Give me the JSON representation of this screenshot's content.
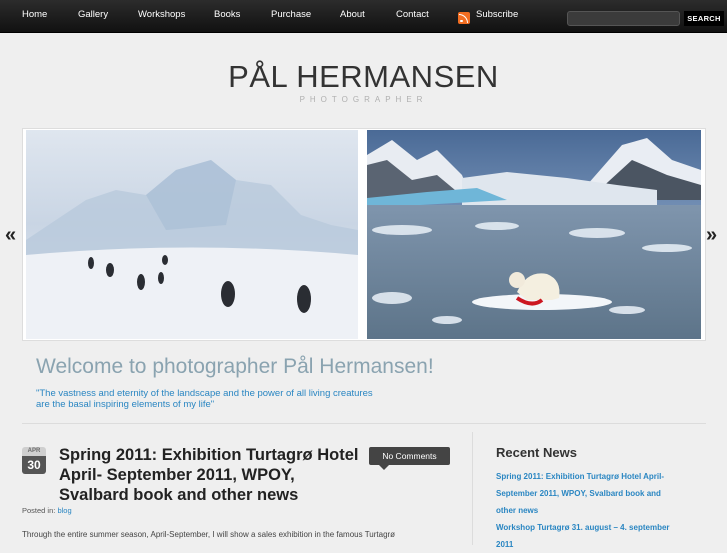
{
  "nav": {
    "items": [
      "Home",
      "Gallery",
      "Workshops",
      "Books",
      "Purchase",
      "About",
      "Contact"
    ],
    "subscribe": "Subscribe",
    "search_button": "SEARCH",
    "search_value": ""
  },
  "logo": {
    "title": "PÅL HERMANSEN",
    "subtitle": "PHOTOGRAPHER"
  },
  "slider": {
    "prev": "«",
    "next": "»"
  },
  "welcome": {
    "heading": "Welcome to photographer Pål Hermansen!",
    "quote_line1": "\"The vastness and eternity of the landscape and the power of all living creatures",
    "quote_line2": "are the basal inspiring elements of my life\""
  },
  "post": {
    "month": "APR",
    "day": "30",
    "title": "Spring 2011: Exhibition Turtagrø Hotel April- September 2011, WPOY, Svalbard book and other news",
    "comments": "No Comments",
    "posted_in_label": "Posted in:",
    "category": "blog",
    "excerpt": "Through the entire summer season, April-September, I will show a sales exhibition in the famous Turtagrø"
  },
  "sidebar": {
    "title": "Recent News",
    "news": [
      "Spring 2011: Exhibition Turtagrø Hotel April-",
      "September 2011, WPOY, Svalbard book and",
      "other news",
      "Workshop Turtagrø 31. august – 4. september",
      "2011"
    ]
  },
  "colors": {
    "accent": "#2a86c2",
    "welcome": "#8aa3b0",
    "nav_bg": "#1c1c1c",
    "rss": "#f26e22"
  }
}
